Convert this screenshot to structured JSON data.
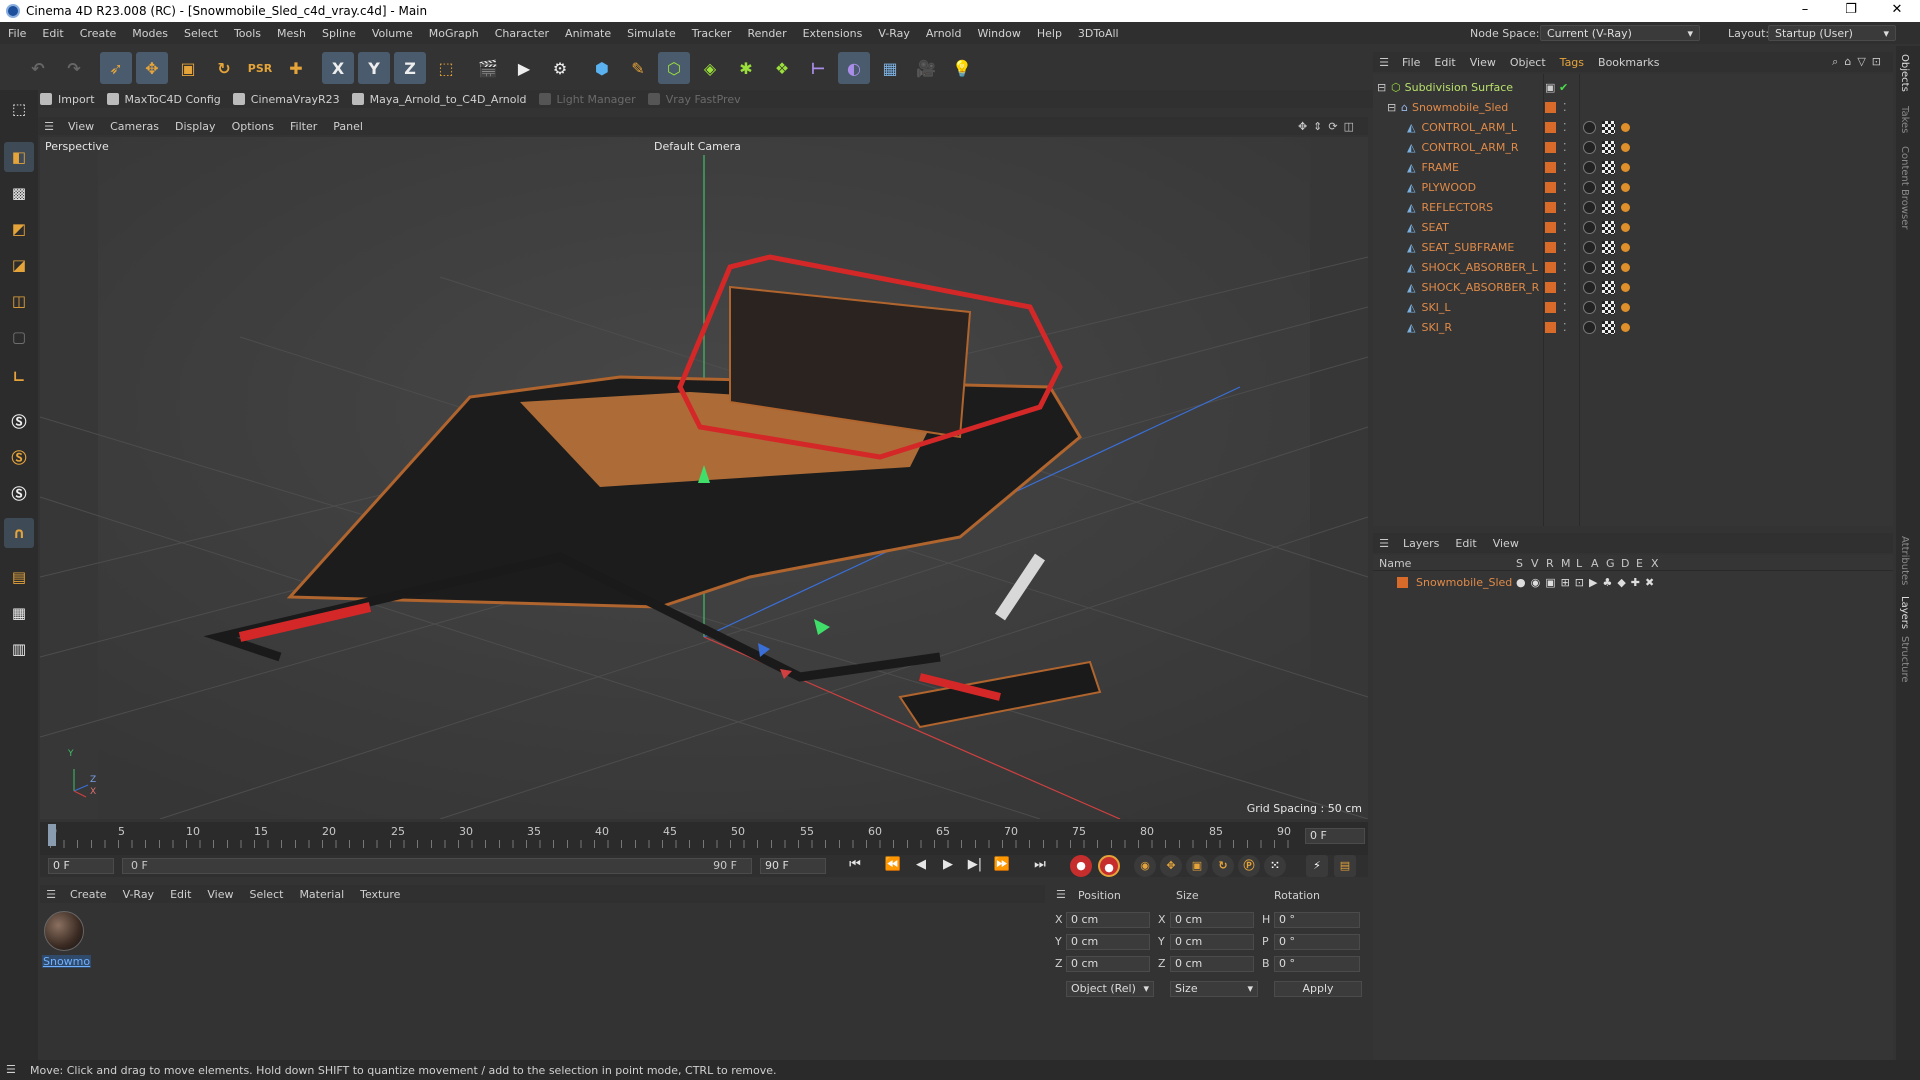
{
  "window": {
    "title": "Cinema 4D R23.008 (RC) - [Snowmobile_Sled_c4d_vray.c4d] - Main",
    "minimize": "–",
    "maximize": "❐",
    "close": "✕"
  },
  "menu": [
    "File",
    "Edit",
    "Create",
    "Modes",
    "Select",
    "Tools",
    "Mesh",
    "Spline",
    "Volume",
    "MoGraph",
    "Character",
    "Animate",
    "Simulate",
    "Tracker",
    "Render",
    "Extensions",
    "V-Ray",
    "Arnold",
    "Window",
    "Help",
    "3DToAll"
  ],
  "node_space": {
    "label": "Node Space:",
    "value": "Current (V-Ray)"
  },
  "layout": {
    "label": "Layout:",
    "value": "Startup (User)"
  },
  "toolbar": {
    "x_axis": "X",
    "y_axis": "Y",
    "z_axis": "Z"
  },
  "plugin_bar": [
    {
      "label": "Import",
      "enabled": true
    },
    {
      "label": "MaxToC4D Config",
      "enabled": true
    },
    {
      "label": "CinemaVrayR23",
      "enabled": true
    },
    {
      "label": "Maya_Arnold_to_C4D_Arnold",
      "enabled": true
    },
    {
      "label": "Light Manager",
      "enabled": false
    },
    {
      "label": "Vray FastPrev",
      "enabled": false
    }
  ],
  "viewport_menu": [
    "View",
    "Cameras",
    "Display",
    "Options",
    "Filter",
    "Panel"
  ],
  "viewport": {
    "name": "Perspective",
    "camera": "Default Camera",
    "grid_spacing": "Grid Spacing : 50 cm",
    "axis_y": "Y",
    "axis_z": "Z",
    "axis_x": "X"
  },
  "timeline": {
    "ticks": [
      "0",
      "5",
      "10",
      "15",
      "20",
      "25",
      "30",
      "35",
      "40",
      "45",
      "50",
      "55",
      "60",
      "65",
      "70",
      "75",
      "80",
      "85",
      "90"
    ],
    "current_frame": "0 F"
  },
  "transport": {
    "start_field": "0 F",
    "range_start": "0 F",
    "range_end": "90 F",
    "end_field": "90 F"
  },
  "material_menu": [
    "Create",
    "V-Ray",
    "Edit",
    "View",
    "Select",
    "Material",
    "Texture"
  ],
  "materials": [
    {
      "name": "Snowmo"
    }
  ],
  "coordinates": {
    "position_header": "Position",
    "size_header": "Size",
    "rotation_header": "Rotation",
    "rows": [
      {
        "axis": "X",
        "pos": "0 cm",
        "size_axis": "X",
        "size": "0 cm",
        "rot_axis": "H",
        "rot": "0 °"
      },
      {
        "axis": "Y",
        "pos": "0 cm",
        "size_axis": "Y",
        "size": "0 cm",
        "rot_axis": "P",
        "rot": "0 °"
      },
      {
        "axis": "Z",
        "pos": "0 cm",
        "size_axis": "Z",
        "size": "0 cm",
        "rot_axis": "B",
        "rot": "0 °"
      }
    ],
    "mode": "Object (Rel)",
    "size_mode": "Size",
    "apply": "Apply"
  },
  "object_menu": [
    "File",
    "Edit",
    "View",
    "Object",
    "Tags",
    "Bookmarks"
  ],
  "objects": {
    "root": "Subdivision Surface",
    "group": "Snowmobile_Sled",
    "children": [
      "CONTROL_ARM_L",
      "CONTROL_ARM_R",
      "FRAME",
      "PLYWOOD",
      "REFLECTORS",
      "SEAT",
      "SEAT_SUBFRAME",
      "SHOCK_ABSORBER_L",
      "SHOCK_ABSORBER_R",
      "SKI_L",
      "SKI_R"
    ]
  },
  "layers_menu": [
    "Layers",
    "Edit",
    "View"
  ],
  "layers": {
    "columns": [
      "Name",
      "S",
      "V",
      "R",
      "M",
      "L",
      "A",
      "G",
      "D",
      "E",
      "X"
    ],
    "items": [
      "Snowmobile_Sled"
    ]
  },
  "right_tabs": [
    "Objects",
    "Takes",
    "Content Browser",
    "Attributes",
    "Layers",
    "Structure"
  ],
  "status": "Move: Click and drag to move elements. Hold down SHIFT to quantize movement / add to the selection in point mode, CTRL to remove.",
  "colors": {
    "accent": "#e08a48",
    "selection": "#4a5b6e",
    "tool_yellow": "#e5a43a",
    "active_green": "#9adf3b"
  }
}
